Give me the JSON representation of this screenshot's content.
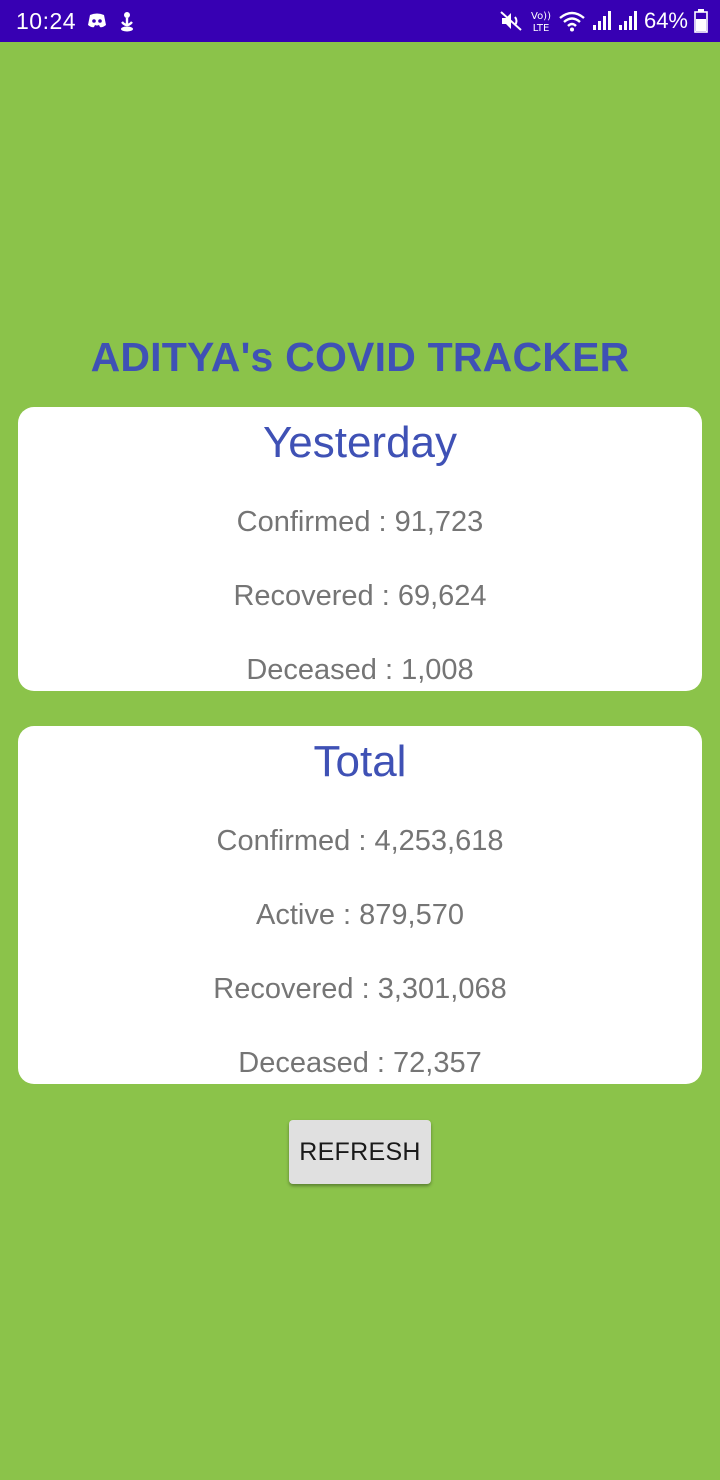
{
  "status_bar": {
    "time": "10:24",
    "battery": "64%",
    "network_badge": "Vo)) LTE",
    "icons": [
      "discord-icon",
      "notification-icon",
      "mute-icon",
      "volte-icon",
      "wifi-icon",
      "signal-icon",
      "signal-icon",
      "battery-icon"
    ],
    "background_color": "#3700b3"
  },
  "app": {
    "title": "ADITYA's COVID TRACKER",
    "background_color": "#8bc34a",
    "accent_color": "#3f51b5"
  },
  "yesterday": {
    "heading": "Yesterday",
    "confirmed": "Confirmed : 91,723",
    "recovered": "Recovered : 69,624",
    "deceased": "Deceased : 1,008"
  },
  "total": {
    "heading": "Total",
    "confirmed": "Confirmed : 4,253,618",
    "active": "Active : 879,570",
    "recovered": "Recovered : 3,301,068",
    "deceased": "Deceased : 72,357"
  },
  "actions": {
    "refresh_label": "REFRESH"
  }
}
